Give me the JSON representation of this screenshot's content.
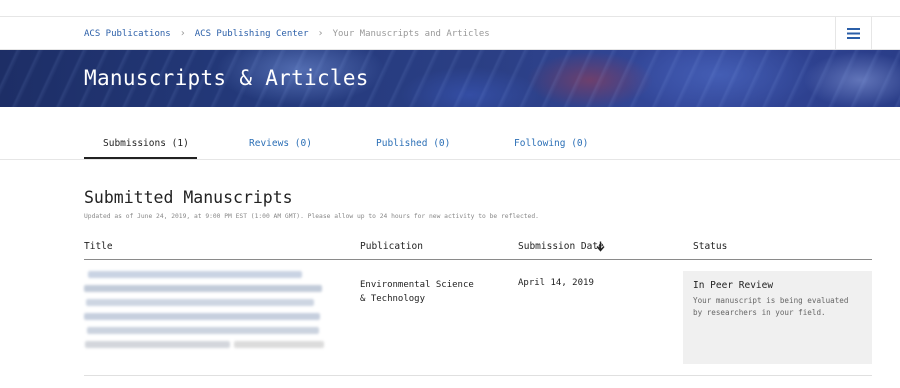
{
  "breadcrumb": {
    "items": [
      "ACS Publications",
      "ACS Publishing Center"
    ],
    "current": "Your Manuscripts and Articles"
  },
  "header": {
    "menu_icon": "hamburger-menu-icon"
  },
  "banner": {
    "title": "Manuscripts & Articles"
  },
  "tabs": [
    {
      "label": "Submissions (1)",
      "active": true
    },
    {
      "label": "Reviews (0)",
      "active": false
    },
    {
      "label": "Published (0)",
      "active": false
    },
    {
      "label": "Following (0)",
      "active": false
    }
  ],
  "section": {
    "title": "Submitted Manuscripts",
    "updated_note": "Updated as of June 24, 2019, at 9:00 PM EST (1:00 AM GMT). Please allow up to 24 hours for new activity to be reflected."
  },
  "table": {
    "columns": [
      "Title",
      "Publication",
      "Submission Date",
      "Status"
    ],
    "sort_icon": "arrow-down-icon",
    "rows": [
      {
        "publication": "Environmental Science\n& Technology",
        "submission_date": "April 14, 2019",
        "status": "In Peer Review",
        "status_description": "Your manuscript is being evaluated by researchers in your field."
      }
    ]
  },
  "colors": {
    "link": "#2b5fa8",
    "banner": "#243a7c",
    "status_bg": "#f0f0f0"
  }
}
